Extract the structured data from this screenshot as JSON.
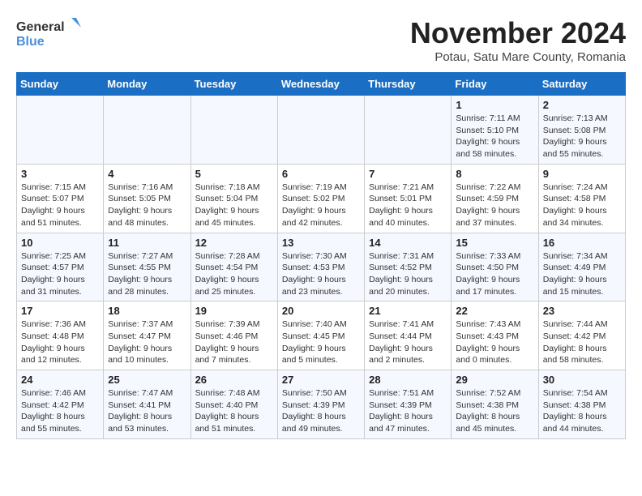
{
  "logo": {
    "line1": "General",
    "line2": "Blue"
  },
  "title": "November 2024",
  "location": "Potau, Satu Mare County, Romania",
  "weekdays": [
    "Sunday",
    "Monday",
    "Tuesday",
    "Wednesday",
    "Thursday",
    "Friday",
    "Saturday"
  ],
  "weeks": [
    [
      {
        "day": "",
        "info": ""
      },
      {
        "day": "",
        "info": ""
      },
      {
        "day": "",
        "info": ""
      },
      {
        "day": "",
        "info": ""
      },
      {
        "day": "",
        "info": ""
      },
      {
        "day": "1",
        "info": "Sunrise: 7:11 AM\nSunset: 5:10 PM\nDaylight: 9 hours and 58 minutes."
      },
      {
        "day": "2",
        "info": "Sunrise: 7:13 AM\nSunset: 5:08 PM\nDaylight: 9 hours and 55 minutes."
      }
    ],
    [
      {
        "day": "3",
        "info": "Sunrise: 7:15 AM\nSunset: 5:07 PM\nDaylight: 9 hours and 51 minutes."
      },
      {
        "day": "4",
        "info": "Sunrise: 7:16 AM\nSunset: 5:05 PM\nDaylight: 9 hours and 48 minutes."
      },
      {
        "day": "5",
        "info": "Sunrise: 7:18 AM\nSunset: 5:04 PM\nDaylight: 9 hours and 45 minutes."
      },
      {
        "day": "6",
        "info": "Sunrise: 7:19 AM\nSunset: 5:02 PM\nDaylight: 9 hours and 42 minutes."
      },
      {
        "day": "7",
        "info": "Sunrise: 7:21 AM\nSunset: 5:01 PM\nDaylight: 9 hours and 40 minutes."
      },
      {
        "day": "8",
        "info": "Sunrise: 7:22 AM\nSunset: 4:59 PM\nDaylight: 9 hours and 37 minutes."
      },
      {
        "day": "9",
        "info": "Sunrise: 7:24 AM\nSunset: 4:58 PM\nDaylight: 9 hours and 34 minutes."
      }
    ],
    [
      {
        "day": "10",
        "info": "Sunrise: 7:25 AM\nSunset: 4:57 PM\nDaylight: 9 hours and 31 minutes."
      },
      {
        "day": "11",
        "info": "Sunrise: 7:27 AM\nSunset: 4:55 PM\nDaylight: 9 hours and 28 minutes."
      },
      {
        "day": "12",
        "info": "Sunrise: 7:28 AM\nSunset: 4:54 PM\nDaylight: 9 hours and 25 minutes."
      },
      {
        "day": "13",
        "info": "Sunrise: 7:30 AM\nSunset: 4:53 PM\nDaylight: 9 hours and 23 minutes."
      },
      {
        "day": "14",
        "info": "Sunrise: 7:31 AM\nSunset: 4:52 PM\nDaylight: 9 hours and 20 minutes."
      },
      {
        "day": "15",
        "info": "Sunrise: 7:33 AM\nSunset: 4:50 PM\nDaylight: 9 hours and 17 minutes."
      },
      {
        "day": "16",
        "info": "Sunrise: 7:34 AM\nSunset: 4:49 PM\nDaylight: 9 hours and 15 minutes."
      }
    ],
    [
      {
        "day": "17",
        "info": "Sunrise: 7:36 AM\nSunset: 4:48 PM\nDaylight: 9 hours and 12 minutes."
      },
      {
        "day": "18",
        "info": "Sunrise: 7:37 AM\nSunset: 4:47 PM\nDaylight: 9 hours and 10 minutes."
      },
      {
        "day": "19",
        "info": "Sunrise: 7:39 AM\nSunset: 4:46 PM\nDaylight: 9 hours and 7 minutes."
      },
      {
        "day": "20",
        "info": "Sunrise: 7:40 AM\nSunset: 4:45 PM\nDaylight: 9 hours and 5 minutes."
      },
      {
        "day": "21",
        "info": "Sunrise: 7:41 AM\nSunset: 4:44 PM\nDaylight: 9 hours and 2 minutes."
      },
      {
        "day": "22",
        "info": "Sunrise: 7:43 AM\nSunset: 4:43 PM\nDaylight: 9 hours and 0 minutes."
      },
      {
        "day": "23",
        "info": "Sunrise: 7:44 AM\nSunset: 4:42 PM\nDaylight: 8 hours and 58 minutes."
      }
    ],
    [
      {
        "day": "24",
        "info": "Sunrise: 7:46 AM\nSunset: 4:42 PM\nDaylight: 8 hours and 55 minutes."
      },
      {
        "day": "25",
        "info": "Sunrise: 7:47 AM\nSunset: 4:41 PM\nDaylight: 8 hours and 53 minutes."
      },
      {
        "day": "26",
        "info": "Sunrise: 7:48 AM\nSunset: 4:40 PM\nDaylight: 8 hours and 51 minutes."
      },
      {
        "day": "27",
        "info": "Sunrise: 7:50 AM\nSunset: 4:39 PM\nDaylight: 8 hours and 49 minutes."
      },
      {
        "day": "28",
        "info": "Sunrise: 7:51 AM\nSunset: 4:39 PM\nDaylight: 8 hours and 47 minutes."
      },
      {
        "day": "29",
        "info": "Sunrise: 7:52 AM\nSunset: 4:38 PM\nDaylight: 8 hours and 45 minutes."
      },
      {
        "day": "30",
        "info": "Sunrise: 7:54 AM\nSunset: 4:38 PM\nDaylight: 8 hours and 44 minutes."
      }
    ]
  ]
}
